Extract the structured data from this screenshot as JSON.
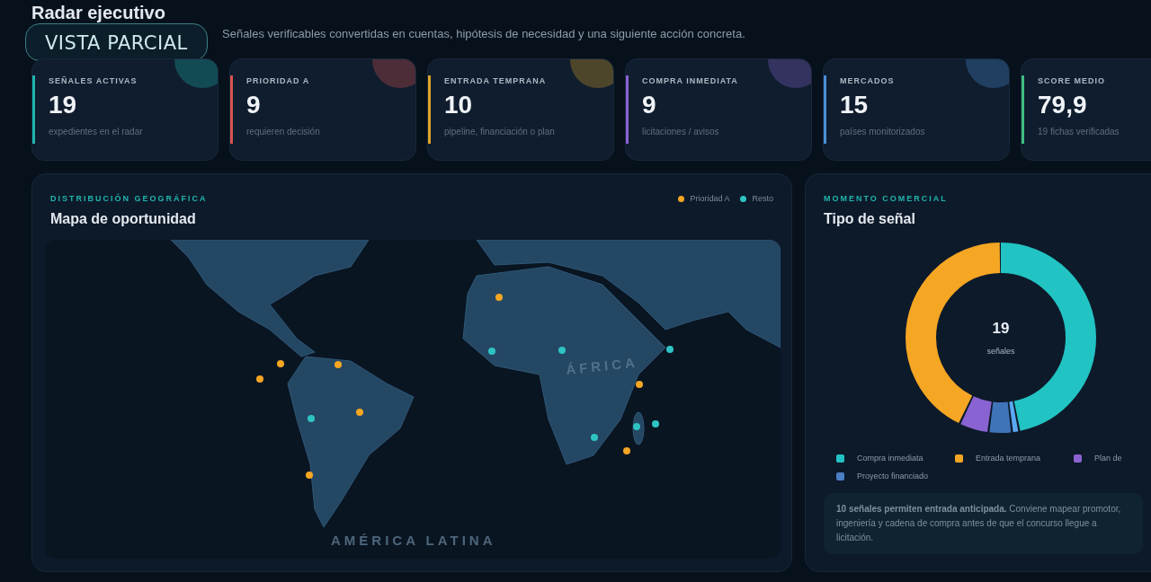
{
  "header": {
    "title": "Radar ejecutivo",
    "subtitle": "Señales verificables convertidas en cuentas, hipótesis de necesidad y una siguiente acción concreta."
  },
  "badge": "VISTA PARCIAL",
  "kpis": [
    {
      "label": "SEÑALES ACTIVAS",
      "value": "19",
      "note": "expedientes en el radar",
      "color": "#1fb5ad"
    },
    {
      "label": "PRIORIDAD A",
      "value": "9",
      "note": "requieren decisión",
      "color": "#d9534f"
    },
    {
      "label": "ENTRADA TEMPRANA",
      "value": "10",
      "note": "pipeline, financiación o plan",
      "color": "#e0a526"
    },
    {
      "label": "COMPRA INMEDIATA",
      "value": "9",
      "note": "licitaciones / avisos",
      "color": "#8a63d2"
    },
    {
      "label": "MERCADOS",
      "value": "15",
      "note": "países monitorizados",
      "color": "#4a8fd6"
    },
    {
      "label": "SCORE MEDIO",
      "value": "79,9",
      "note": "19 fichas verificadas",
      "color": "#3fbf7f"
    }
  ],
  "map_panel": {
    "eyebrow": "DISTRIBUCIÓN GEOGRÁFICA",
    "title": "Mapa de oportunidad",
    "legend": [
      {
        "label": "Prioridad A",
        "color": "#f5a623"
      },
      {
        "label": "Resto",
        "color": "#2ec4c4"
      }
    ],
    "region_labels": [
      "AMÉRICA LATINA",
      "ÁFRICA"
    ],
    "markers": [
      {
        "color": "#f5a623"
      },
      {
        "color": "#f5a623"
      },
      {
        "color": "#f5a623"
      },
      {
        "color": "#f5a623"
      },
      {
        "color": "#f5a623"
      },
      {
        "color": "#f5a623"
      },
      {
        "color": "#f5a623"
      },
      {
        "color": "#f5a623"
      },
      {
        "color": "#2ec4c4"
      },
      {
        "color": "#2ec4c4"
      },
      {
        "color": "#2ec4c4"
      },
      {
        "color": "#2ec4c4"
      },
      {
        "color": "#2ec4c4"
      },
      {
        "color": "#2ec4c4"
      },
      {
        "color": "#2ec4c4"
      }
    ]
  },
  "signal_panel": {
    "eyebrow": "MOMENTO COMERCIAL",
    "title": "Tipo de señal",
    "total": "19",
    "total_label": "señales",
    "legend": [
      {
        "label": "Compra inmediata",
        "color": "#22c3c3"
      },
      {
        "label": "Entrada temprana",
        "color": "#f5a623"
      },
      {
        "label": "Plan de",
        "color": "#8a63d2"
      },
      {
        "label": "Proyecto financiado",
        "color": "#4a7fc4"
      }
    ],
    "note": "**10 señales permiten entrada anticipada.** Conviene mapear promotor, ingeniería y cadena de compra antes de que el concurso llegue a licitación."
  }
}
